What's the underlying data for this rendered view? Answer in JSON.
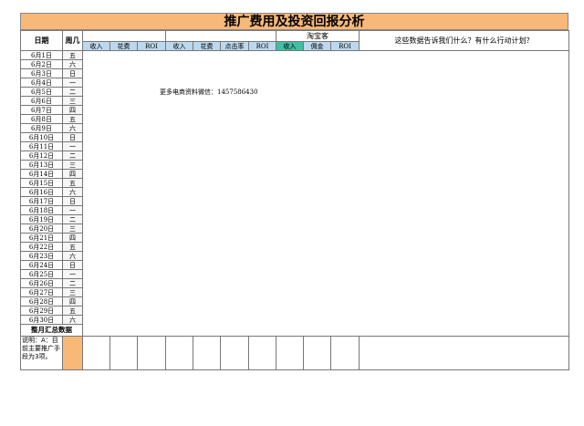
{
  "title": "推广费用及投资回报分析",
  "header": {
    "date": "日期",
    "weekday": "周几",
    "taobaoke": "淘宝客",
    "question": "这些数据告诉我们什么？有什么行动计划？",
    "sub_columns": [
      "收入",
      "花费",
      "ROI",
      "收入",
      "花费",
      "点击率",
      "ROI",
      "收入",
      "佣金",
      "ROI"
    ]
  },
  "rows": [
    {
      "date": "6月1日",
      "weekday": "五"
    },
    {
      "date": "6月2日",
      "weekday": "六"
    },
    {
      "date": "6月3日",
      "weekday": "日"
    },
    {
      "date": "6月4日",
      "weekday": "一"
    },
    {
      "date": "6月5日",
      "weekday": "二"
    },
    {
      "date": "6月6日",
      "weekday": "三"
    },
    {
      "date": "6月7日",
      "weekday": "四"
    },
    {
      "date": "6月8日",
      "weekday": "五"
    },
    {
      "date": "6月9日",
      "weekday": "六"
    },
    {
      "date": "6月10日",
      "weekday": "日"
    },
    {
      "date": "6月11日",
      "weekday": "一"
    },
    {
      "date": "6月12日",
      "weekday": "二"
    },
    {
      "date": "6月13日",
      "weekday": "三"
    },
    {
      "date": "6月14日",
      "weekday": "四"
    },
    {
      "date": "6月15日",
      "weekday": "五"
    },
    {
      "date": "6月16日",
      "weekday": "六"
    },
    {
      "date": "6月17日",
      "weekday": "日"
    },
    {
      "date": "6月18日",
      "weekday": "一"
    },
    {
      "date": "6月19日",
      "weekday": "二"
    },
    {
      "date": "6月20日",
      "weekday": "三"
    },
    {
      "date": "6月21日",
      "weekday": "四"
    },
    {
      "date": "6月22日",
      "weekday": "五"
    },
    {
      "date": "6月23日",
      "weekday": "六"
    },
    {
      "date": "6月24日",
      "weekday": "日"
    },
    {
      "date": "6月25日",
      "weekday": "一"
    },
    {
      "date": "6月26日",
      "weekday": "二"
    },
    {
      "date": "6月27日",
      "weekday": "三"
    },
    {
      "date": "6月28日",
      "weekday": "四"
    },
    {
      "date": "6月29日",
      "weekday": "五"
    },
    {
      "date": "6月30日",
      "weekday": "六"
    }
  ],
  "summary_label": "整月汇总数据",
  "note": "说明：A：目前主要推广手段为3项。",
  "overlay_text": "更多电商资料微信：1457586430",
  "colors": {
    "title_bg": "#f8b878",
    "sub_header_bg": "#bcd8ef",
    "teal": "#3fbfa3"
  }
}
